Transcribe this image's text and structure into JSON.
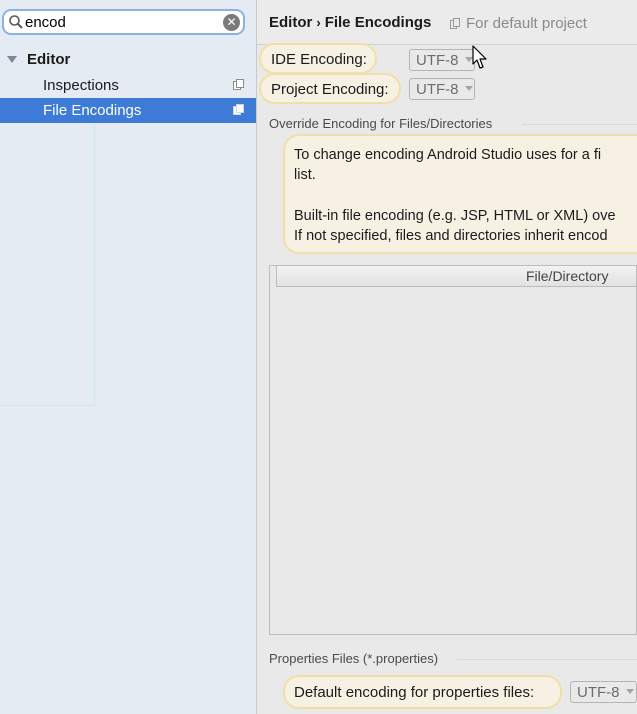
{
  "search": {
    "value": "encod"
  },
  "sidebar": {
    "group_label": "Editor",
    "items": [
      {
        "label": "Inspections"
      },
      {
        "label": "File Encodings"
      }
    ]
  },
  "header": {
    "crumb_parent": "Editor",
    "crumb_separator": "›",
    "crumb_current": "File Encodings",
    "scope": "For default project"
  },
  "ide_encoding": {
    "label": "IDE Encoding:",
    "value": "UTF-8"
  },
  "project_encoding": {
    "label": "Project Encoding:",
    "value": "UTF-8"
  },
  "override_section": {
    "title": "Override Encoding for Files/Directories",
    "info_lines": [
      "To change encoding Android Studio uses for a fi",
      "list.",
      "Built-in file encoding (e.g. JSP, HTML or XML) ove",
      "If not specified, files and directories inherit encod"
    ]
  },
  "table": {
    "column_header": "File/Directory"
  },
  "properties_section": {
    "title": "Properties Files (*.properties)",
    "default_label": "Default encoding for properties files:",
    "default_value": "UTF-8"
  },
  "colors": {
    "selection": "#3d7bd6",
    "highlight": "#f6f1e3",
    "highlight_border": "#f1dfaa",
    "search_border": "#8bb2e3"
  }
}
